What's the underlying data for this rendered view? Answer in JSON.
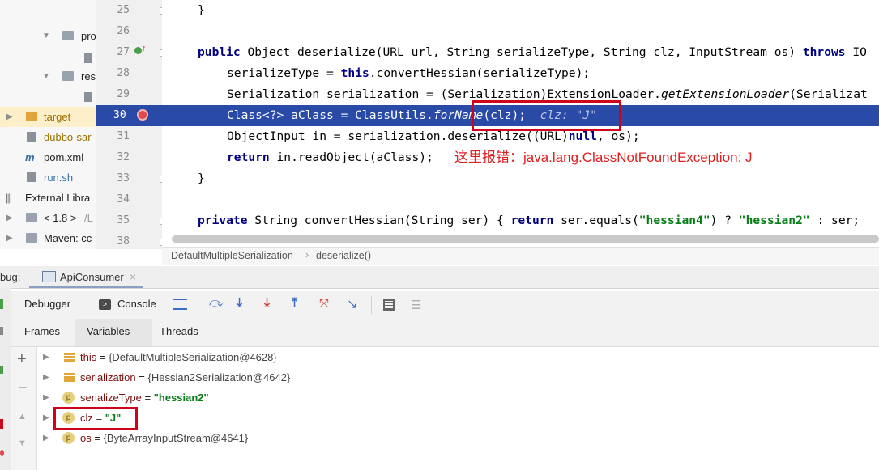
{
  "project_tree": {
    "items": [
      {
        "label": "pro",
        "color": "#333"
      },
      {
        "label": "",
        "color": "#333"
      },
      {
        "label": "res",
        "color": "#333"
      },
      {
        "label": "",
        "color": "#333"
      },
      {
        "label": "target",
        "color": "#9a6f00"
      },
      {
        "label": "dubbo-sar",
        "color": "#9a6f00"
      },
      {
        "label": "pom.xml",
        "color": "#333"
      },
      {
        "label": "run.sh",
        "color": "#3a6fa8"
      },
      {
        "label": "External Libra",
        "color": "#333"
      },
      {
        "label": "< 1.8 >",
        "suffix": "/L",
        "color": "#333"
      },
      {
        "label": "Maven: cc",
        "color": "#333"
      }
    ]
  },
  "editor": {
    "line_numbers": [
      "25",
      "26",
      "27",
      "28",
      "29",
      "30",
      "31",
      "32",
      "33",
      "34",
      "35",
      "38"
    ],
    "lines": {
      "l25": "}",
      "l27a": "public",
      "l27b": " Object deserialize(URL url, String ",
      "l27c": "serializeType",
      "l27d": ", String clz, InputStream os) ",
      "l27e": "throws",
      "l27f": " IO",
      "l28a": "serializeType",
      "l28b": " = ",
      "l28c": "this",
      "l28d": ".convertHessian(",
      "l28e": "serializeType",
      "l28f": ");",
      "l29a": "Serialization serialization = (Serialization)ExtensionLoader.",
      "l29b": "getExtensionLoader",
      "l29c": "(Serializat",
      "l30a": "Class<?> aClass = ClassUtils.",
      "l30b": "forName",
      "l30c": "(clz);",
      "l30d": "clz: \"J\"",
      "l31a": "ObjectInput in = serialization.deserialize((URL)",
      "l31b": "null",
      "l31c": ", os);",
      "l32a": "return",
      "l32b": " in.readObject(aClass);",
      "l33": "}",
      "l35a": "private",
      "l35b": " String convertHessian(String ser) { ",
      "l35c": "return",
      "l35d": " ser.equals(",
      "l35e": "\"hessian4\"",
      "l35f": ") ? ",
      "l35g": "\"hessian2\"",
      "l35h": " : ser; "
    },
    "annotation": "这里报错：java.lang.ClassNotFoundException: J"
  },
  "breadcrumb": {
    "items": [
      "DefaultMultipleSerialization",
      "deserialize()"
    ]
  },
  "debug": {
    "label": "bug:",
    "session": "ApiConsumer",
    "tabs": [
      "Debugger",
      "Console"
    ],
    "subtabs": [
      "Frames",
      "Variables",
      "Threads"
    ],
    "active_subtab": "Variables"
  },
  "variables": [
    {
      "icon": "field",
      "name": "this",
      "eq": " = ",
      "value": "{DefaultMultipleSerialization@4628}",
      "string": false
    },
    {
      "icon": "field",
      "name": "serialization",
      "eq": " = ",
      "value": "{Hessian2Serialization@4642}",
      "string": false
    },
    {
      "icon": "p",
      "name": "serializeType",
      "eq": " = ",
      "value": "\"hessian2\"",
      "string": true
    },
    {
      "icon": "p",
      "name": "clz",
      "eq": " = ",
      "value": "\"J\"",
      "string": true
    },
    {
      "icon": "p",
      "name": "os",
      "eq": " = ",
      "value": "{ByteArrayInputStream@4641}",
      "string": false
    }
  ],
  "colors": {
    "exec_line": "#2a4aa8",
    "highlight_box": "#d0021b",
    "annotation": "#e02020"
  }
}
